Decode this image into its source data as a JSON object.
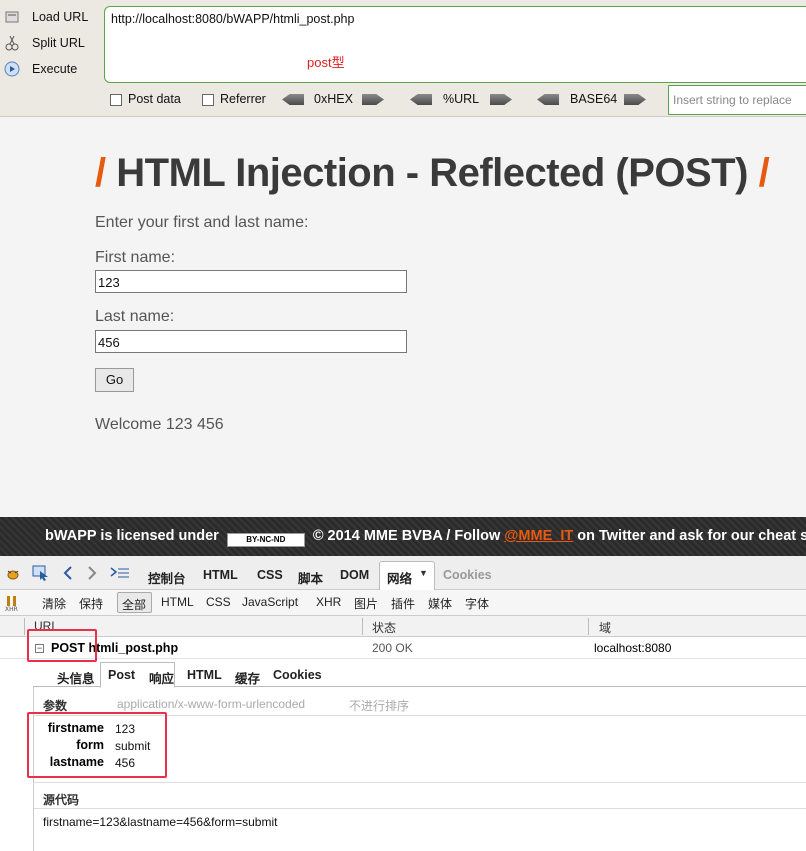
{
  "hackbar": {
    "load_url": "Load URL",
    "split_url": "Split URL",
    "execute": "Execute",
    "url": "http://localhost:8080/bWAPP/htmli_post.php",
    "annotation": "post型",
    "post_data": "Post data",
    "referrer": "Referrer",
    "hex": "0xHEX",
    "url_enc": "%URL",
    "base64": "BASE64",
    "replace_placeholder": "Insert string to replace"
  },
  "page": {
    "title": "HTML Injection - Reflected (POST)",
    "prompt": "Enter your first and last name:",
    "first_label": "First name:",
    "first_value": "123",
    "last_label": "Last name:",
    "last_value": "456",
    "go": "Go",
    "welcome": "Welcome 123 456"
  },
  "footer": {
    "prefix": "bWAPP is licensed under",
    "cc": "BY-NC-ND",
    "middle": "© 2014 MME BVBA / Follow",
    "link": "@MME_IT",
    "suffix": "on Twitter and ask for our cheat sheet"
  },
  "firebug": {
    "tabs": [
      "控制台",
      "HTML",
      "CSS",
      "脚本",
      "DOM",
      "网络",
      "Cookies"
    ],
    "filters": [
      "清除",
      "保持",
      "全部",
      "HTML",
      "CSS",
      "JavaScript",
      "XHR",
      "图片",
      "插件",
      "媒体",
      "字体"
    ],
    "columns": {
      "url": "URL",
      "status": "状态",
      "domain": "域"
    },
    "request": {
      "method_name": "POST htmli_post.php",
      "status": "200 OK",
      "domain": "localhost:8080"
    },
    "detail_tabs": [
      "头信息",
      "Post",
      "响应",
      "HTML",
      "缓存",
      "Cookies"
    ],
    "params_header": "参数",
    "content_type": "application/x-www-form-urlencoded",
    "no_sort": "不进行排序",
    "params": [
      {
        "key": "firstname",
        "value": "123"
      },
      {
        "key": "form",
        "value": "submit"
      },
      {
        "key": "lastname",
        "value": "456"
      }
    ],
    "source_header": "源代码",
    "source": "firstname=123&lastname=456&form=submit"
  },
  "colors": {
    "accent": "#e85a10",
    "highlight": "#e8304a",
    "hackbar_border": "#5aa54a"
  }
}
